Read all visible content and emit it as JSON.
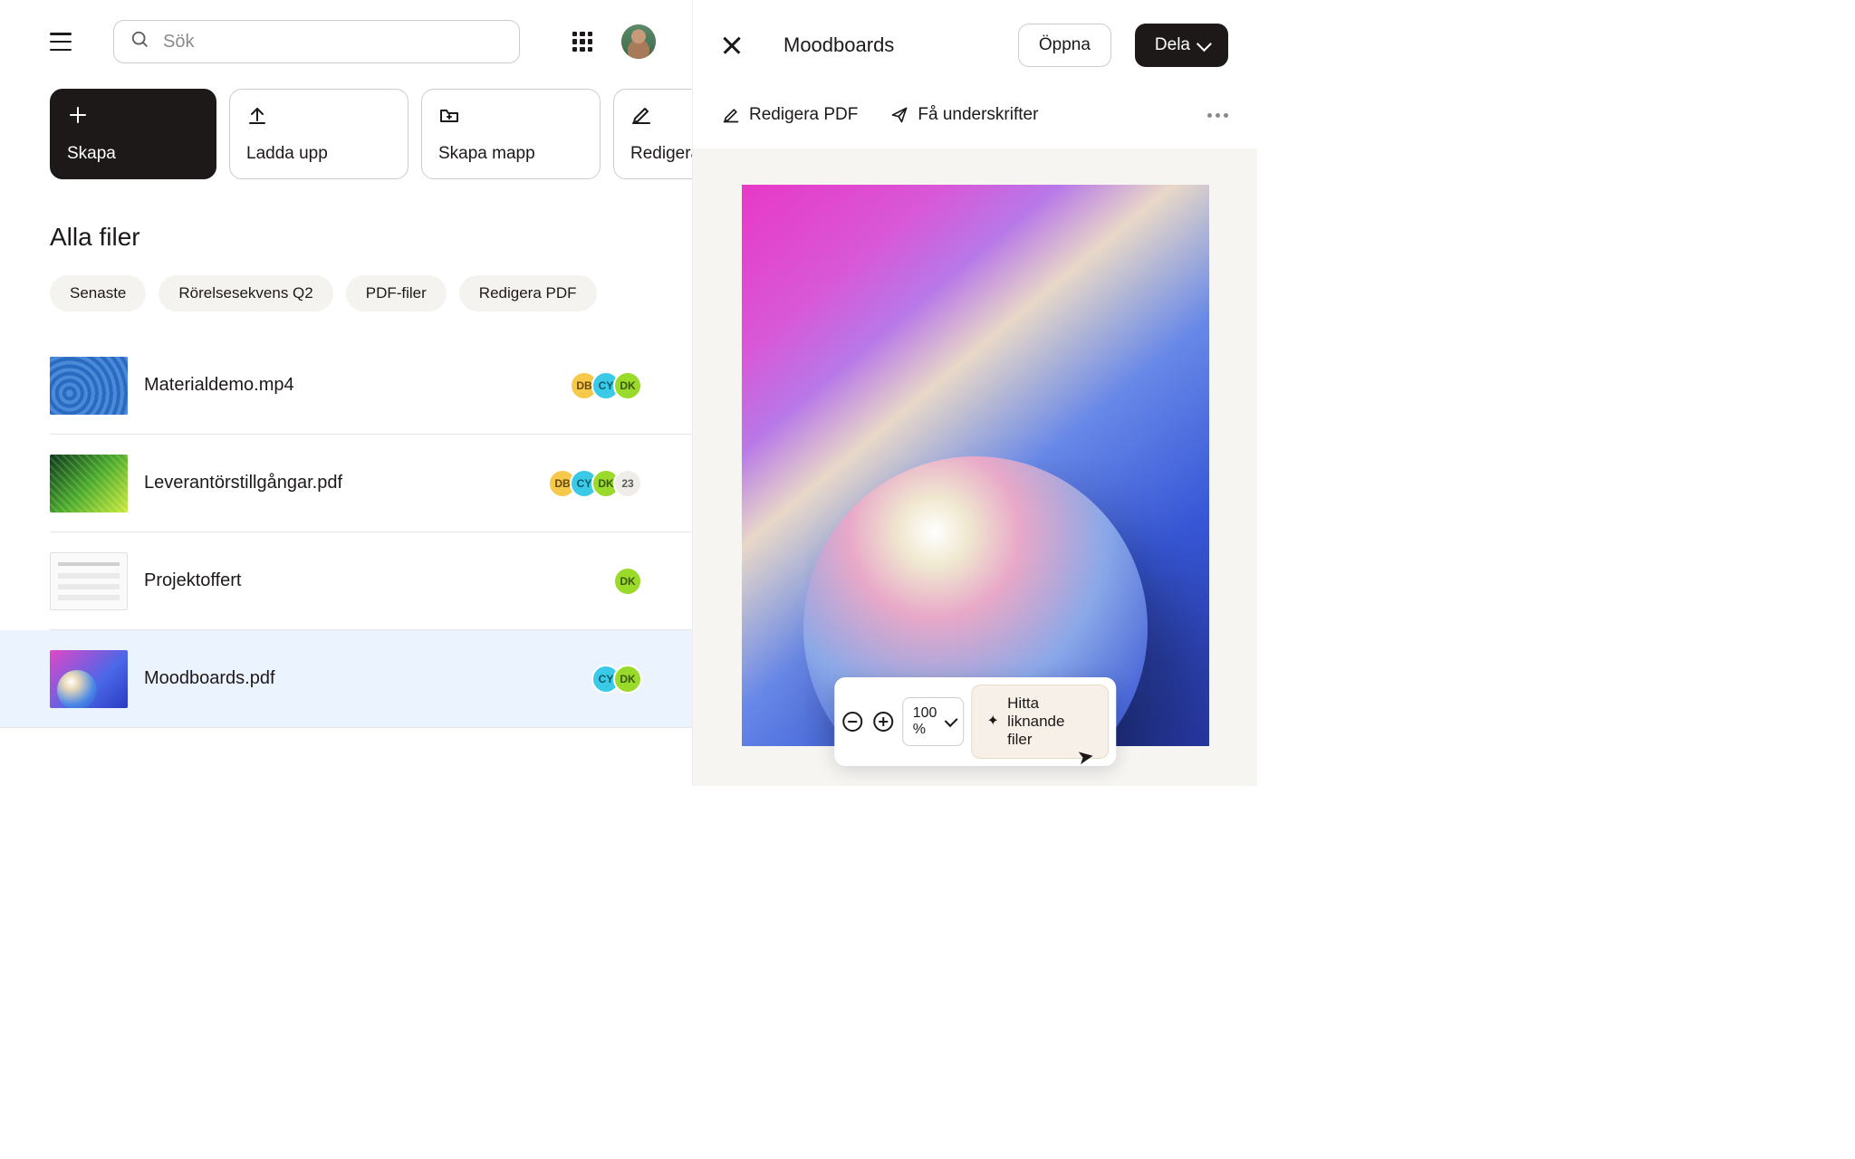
{
  "search": {
    "placeholder": "Sök"
  },
  "actions": [
    {
      "id": "create",
      "label": "Skapa"
    },
    {
      "id": "upload",
      "label": "Ladda upp"
    },
    {
      "id": "create-folder",
      "label": "Skapa mapp"
    },
    {
      "id": "edit-pdf",
      "label": "Redigera PDF"
    }
  ],
  "section_title": "Alla filer",
  "chips": [
    {
      "label": "Senaste"
    },
    {
      "label": "Rörelsesekvens Q2"
    },
    {
      "label": "PDF-filer"
    },
    {
      "label": "Redigera PDF"
    }
  ],
  "files": [
    {
      "name": "Materialdemo.mp4",
      "shares": [
        "DB",
        "CY",
        "DK"
      ],
      "more": null
    },
    {
      "name": "Leverantörstillgångar.pdf",
      "shares": [
        "DB",
        "CY",
        "DK"
      ],
      "more": "23"
    },
    {
      "name": "Projektoffert",
      "shares": [
        "DK"
      ],
      "more": null
    },
    {
      "name": "Moodboards.pdf",
      "shares": [
        "CY",
        "DK"
      ],
      "more": null
    }
  ],
  "preview": {
    "title": "Moodboards",
    "open": "Öppna",
    "share": "Dela",
    "tool_edit_pdf": "Redigera PDF",
    "tool_signatures": "Få underskrifter",
    "zoom": "100 %",
    "similar": "Hitta liknande filer"
  }
}
